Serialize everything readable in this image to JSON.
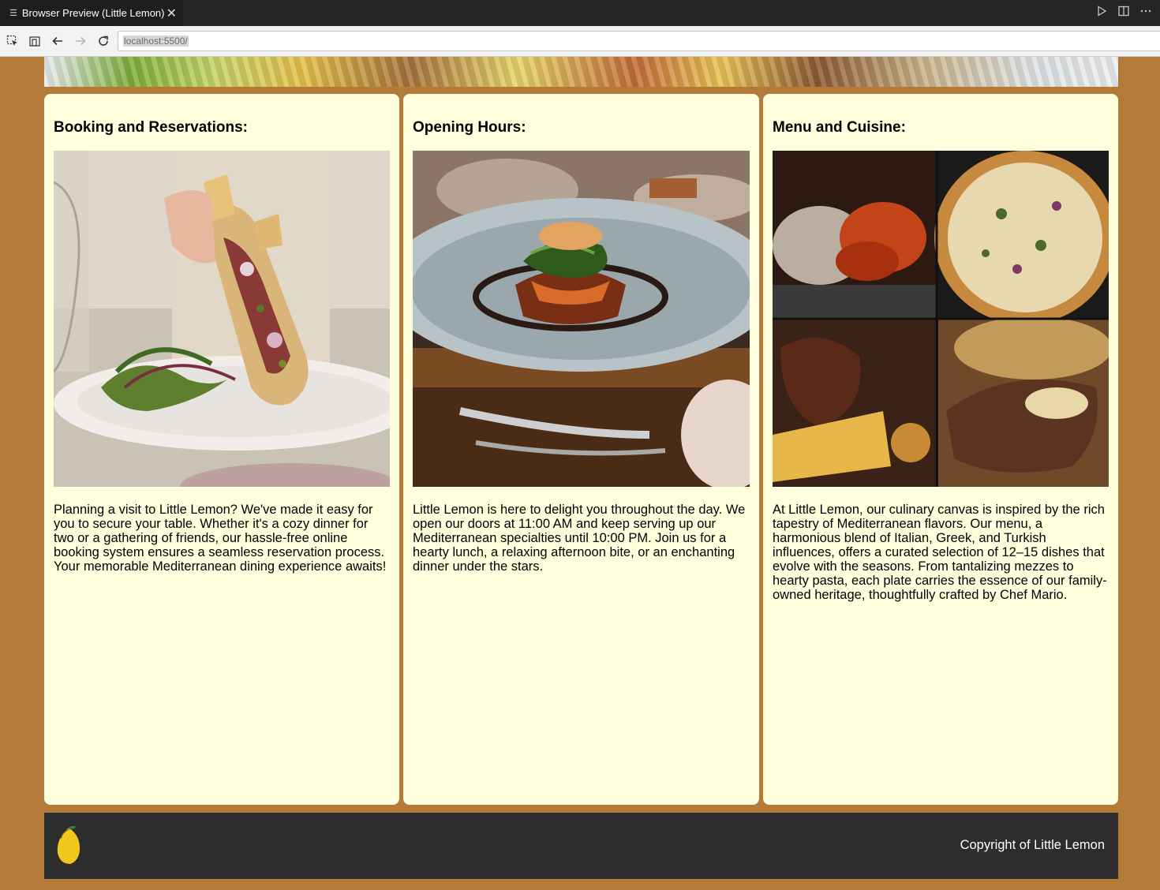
{
  "window": {
    "tab_title": "Browser Preview (Little Lemon)",
    "url": "localhost:5500/"
  },
  "icons": {
    "tab_menu": "menu-lines-icon",
    "tab_close": "close-icon",
    "run": "play-icon",
    "split": "split-editor-icon",
    "more": "more-icon",
    "inspect": "inspect-icon",
    "device": "device-toggle-icon",
    "back": "arrow-left-icon",
    "forward": "arrow-right-icon",
    "reload": "reload-icon",
    "logo": "lemon-logo-icon"
  },
  "cards": [
    {
      "heading": "Booking and Reservations:",
      "text": "Planning a visit to Little Lemon? We've made it easy for you to secure your table. Whether it's a cozy dinner for two or a gathering of friends, our hassle-free online booking system ensures a seamless reservation process. Your memorable Mediterranean dining experience awaits!"
    },
    {
      "heading": "Opening Hours:",
      "text": "Little Lemon is here to delight you throughout the day. We open our doors at 11:00 AM and keep serving up our Mediterranean specialties until 10:00 PM. Join us for a hearty lunch, a relaxing afternoon bite, or an enchanting dinner under the stars."
    },
    {
      "heading": "Menu and Cuisine:",
      "text": "At Little Lemon, our culinary canvas is inspired by the rich tapestry of Mediterranean flavors. Our menu, a harmonious blend of Italian, Greek, and Turkish influences, offers a curated selection of 12–15 dishes that evolve with the seasons. From tantalizing mezzes to hearty pasta, each plate carries the essence of our family-owned heritage, thoughtfully crafted by Chef Mario."
    }
  ],
  "footer": {
    "copyright": "Copyright of Little Lemon"
  },
  "colors": {
    "page_background": "#b47a37",
    "card_background": "#ffffde",
    "footer_background": "#2d2d2d",
    "lemon": "#f2c81c"
  }
}
